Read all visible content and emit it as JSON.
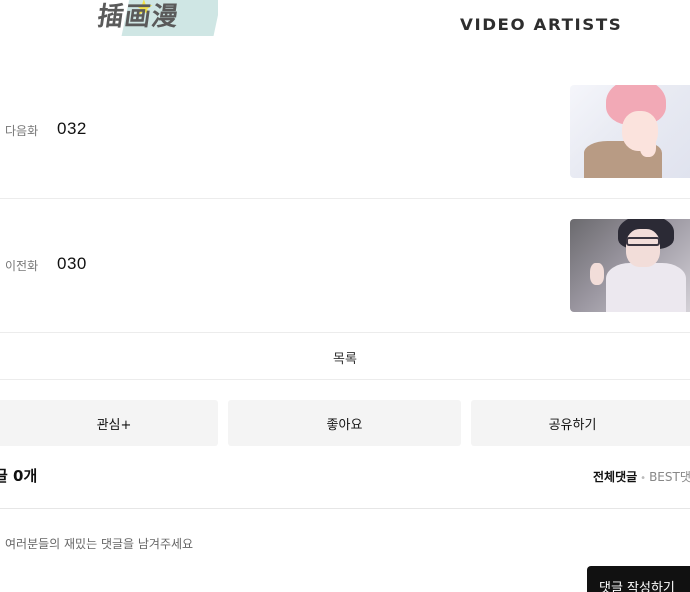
{
  "header": {
    "logo_left_text": "插画漫",
    "logo_right_text": "VIDEO ARTISTS"
  },
  "episodes": {
    "next": {
      "label": "다음화",
      "number": "032"
    },
    "prev": {
      "label": "이전화",
      "number": "030"
    }
  },
  "list_link": "목록",
  "actions": {
    "interest": "관심+",
    "like": "좋아요",
    "share": "공유하기"
  },
  "comments": {
    "count_label": "글 0개",
    "tab_all": "전체댓글",
    "tab_sep": "•",
    "tab_best": "BEST댓",
    "placeholder": "여러분들의 재밌는 댓글을 남겨주세요",
    "write_button": "댓글 작성하기"
  },
  "icons": {
    "logo_star": "star-icon"
  }
}
